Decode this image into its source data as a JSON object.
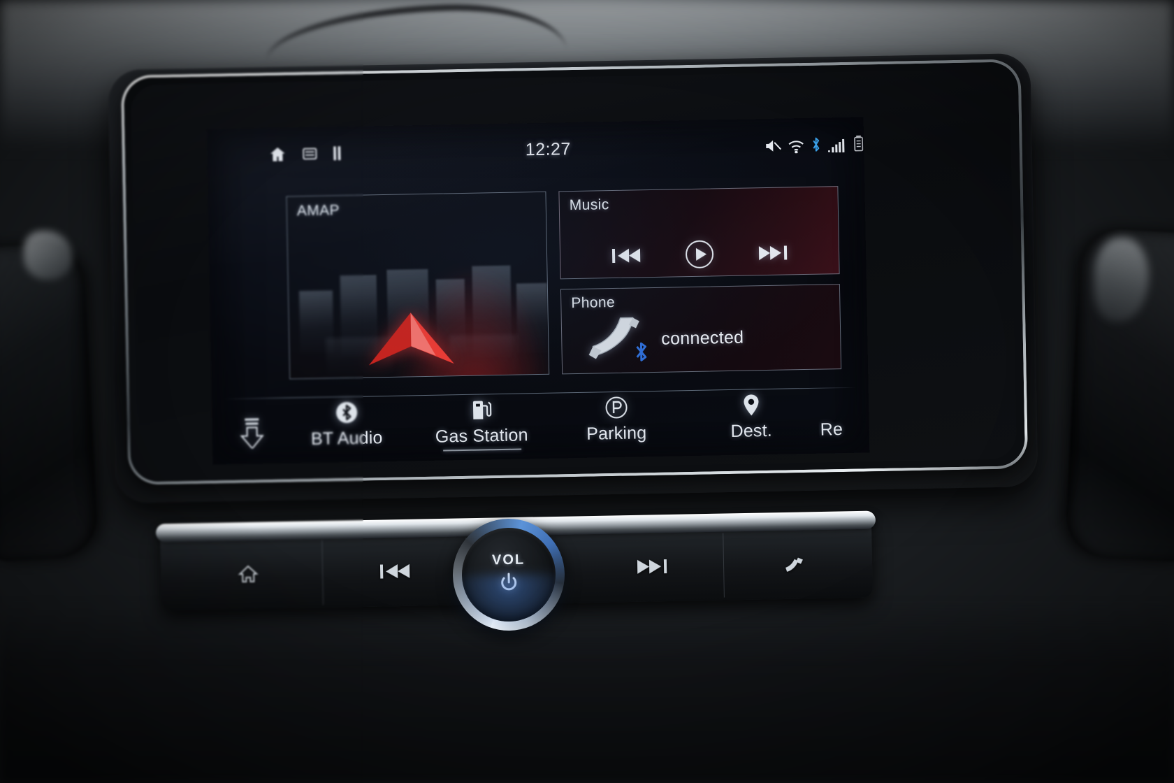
{
  "device": {
    "type": "car-infotainment-head-unit",
    "knob": {
      "label": "VOL",
      "icon": "power-icon"
    }
  },
  "status_bar": {
    "home_icon": "home-icon",
    "list_icon": "list-icon",
    "pause_icon": "pause-icon",
    "time": "12:27",
    "right_icons": [
      {
        "name": "mute-icon",
        "color": "#e8ecf2"
      },
      {
        "name": "wifi-icon",
        "color": "#e8ecf2"
      },
      {
        "name": "bluetooth-icon",
        "color": "#3aa0e8"
      },
      {
        "name": "signal-bars-icon",
        "color": "#e8ecf2"
      },
      {
        "name": "battery-icon",
        "color": "#e8ecf2"
      }
    ]
  },
  "widgets": {
    "map": {
      "title": "AMAP",
      "cursor_icon": "navigation-arrow-icon",
      "cursor_color": "#e8342f"
    },
    "music": {
      "title": "Music",
      "prev_icon": "previous-track-icon",
      "play_icon": "play-icon",
      "next_icon": "next-track-icon"
    },
    "phone": {
      "title": "Phone",
      "handset_icon": "phone-handset-icon",
      "bluetooth_badge_icon": "bluetooth-icon",
      "bluetooth_color": "#2f6fd8",
      "status": "connected"
    }
  },
  "shortcut_bar": {
    "pulldown_icon": "pull-down-arrow-icon",
    "items": [
      {
        "icon": "bluetooth-circle-icon",
        "label": "BT Audio",
        "active": false
      },
      {
        "icon": "gas-pump-icon",
        "label": "Gas Station",
        "active": true
      },
      {
        "icon": "parking-circle-icon",
        "label": "Parking",
        "active": false
      },
      {
        "icon": "map-pin-icon",
        "label": "Dest.",
        "active": false
      },
      {
        "icon": "",
        "label": "Re",
        "active": false
      }
    ]
  },
  "hardware_buttons": [
    {
      "name": "home-hard-button",
      "icon": "home-icon"
    },
    {
      "name": "previous-hard-button",
      "icon": "previous-track-icon"
    },
    {
      "name": "next-hard-button",
      "icon": "next-track-icon"
    },
    {
      "name": "call-hard-button",
      "icon": "phone-icon"
    }
  ]
}
